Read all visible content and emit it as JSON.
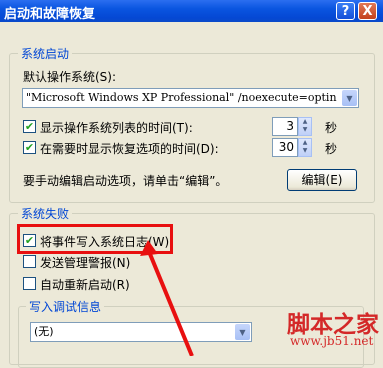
{
  "window": {
    "title": "启动和故障恢复",
    "help_label": "?",
    "close_label": "X"
  },
  "system_startup": {
    "group_title": "系统启动",
    "default_os_label": "默认操作系统(S):",
    "default_os_value": "\"Microsoft Windows XP Professional\" /noexecute=optin",
    "show_os_list_label": "显示操作系统列表的时间(T):",
    "show_os_list_checked": true,
    "show_os_list_value": "3",
    "show_recovery_label": "在需要时显示恢复选项的时间(D):",
    "show_recovery_checked": true,
    "show_recovery_value": "30",
    "seconds_label": "秒",
    "edit_hint": "要手动编辑启动选项，请单击“编辑”。",
    "edit_button": "编辑(E)"
  },
  "system_failure": {
    "group_title": "系统失败",
    "write_event_label": "将事件写入系统日志(W)",
    "write_event_checked": true,
    "send_alert_label": "发送管理警报(N)",
    "send_alert_checked": false,
    "auto_restart_label": "自动重新启动(R)",
    "auto_restart_checked": false,
    "debug_group_title": "写入调试信息",
    "debug_value": "(无)"
  },
  "watermark": {
    "main": "脚本之家",
    "url": "www.jb51.net"
  },
  "colors": {
    "highlight": "#e81010",
    "titlebar": "#0a55e0"
  }
}
